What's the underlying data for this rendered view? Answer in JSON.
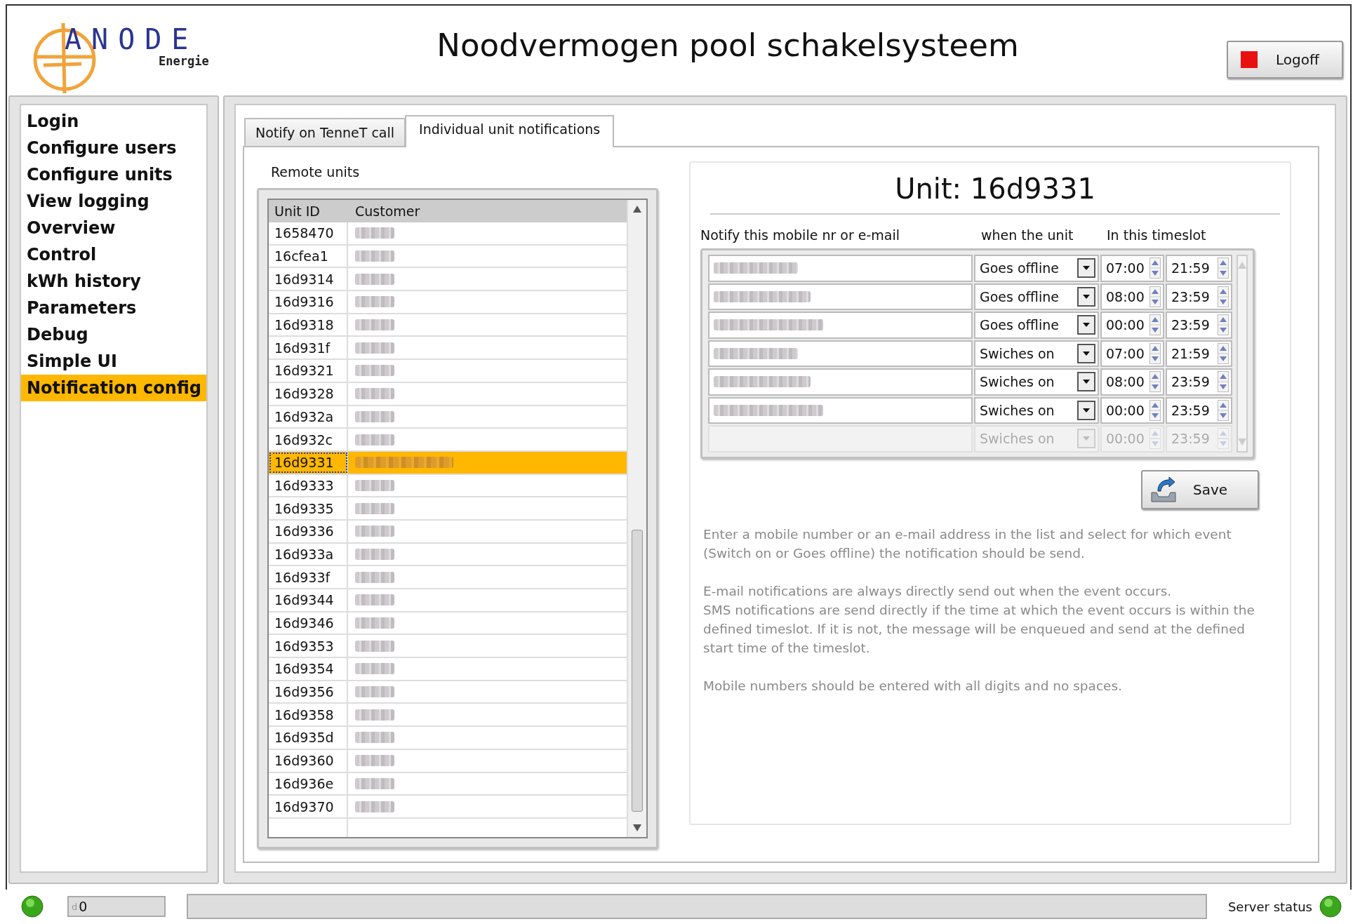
{
  "header": {
    "logo": {
      "name": "ANODE",
      "tagline": "Energie"
    },
    "title": "Noodvermogen pool schakelsysteem",
    "logoff": {
      "label": "Logoff"
    }
  },
  "sidebar": {
    "items": [
      {
        "label": "Login",
        "selected": false
      },
      {
        "label": "Configure users",
        "selected": false
      },
      {
        "label": "Configure units",
        "selected": false
      },
      {
        "label": "View logging",
        "selected": false
      },
      {
        "label": "Overview",
        "selected": false
      },
      {
        "label": "Control",
        "selected": false
      },
      {
        "label": "kWh history",
        "selected": false
      },
      {
        "label": "Parameters",
        "selected": false
      },
      {
        "label": "Debug",
        "selected": false
      },
      {
        "label": "Simple UI",
        "selected": false
      },
      {
        "label": "Notification config",
        "selected": true
      }
    ]
  },
  "tabs": [
    {
      "label": "Notify on TenneT call",
      "selected": false
    },
    {
      "label": "Individual unit notifications",
      "selected": true
    }
  ],
  "remote_units": {
    "label": "Remote units",
    "columns": [
      "Unit ID",
      "Customer"
    ],
    "rows": [
      {
        "unit_id": "1658470",
        "selected": false
      },
      {
        "unit_id": "16cfea1",
        "selected": false
      },
      {
        "unit_id": "16d9314",
        "selected": false
      },
      {
        "unit_id": "16d9316",
        "selected": false
      },
      {
        "unit_id": "16d9318",
        "selected": false
      },
      {
        "unit_id": "16d931f",
        "selected": false
      },
      {
        "unit_id": "16d9321",
        "selected": false
      },
      {
        "unit_id": "16d9328",
        "selected": false
      },
      {
        "unit_id": "16d932a",
        "selected": false
      },
      {
        "unit_id": "16d932c",
        "selected": false
      },
      {
        "unit_id": "16d9331",
        "selected": true
      },
      {
        "unit_id": "16d9333",
        "selected": false
      },
      {
        "unit_id": "16d9335",
        "selected": false
      },
      {
        "unit_id": "16d9336",
        "selected": false
      },
      {
        "unit_id": "16d933a",
        "selected": false
      },
      {
        "unit_id": "16d933f",
        "selected": false
      },
      {
        "unit_id": "16d9344",
        "selected": false
      },
      {
        "unit_id": "16d9346",
        "selected": false
      },
      {
        "unit_id": "16d9353",
        "selected": false
      },
      {
        "unit_id": "16d9354",
        "selected": false
      },
      {
        "unit_id": "16d9356",
        "selected": false
      },
      {
        "unit_id": "16d9358",
        "selected": false
      },
      {
        "unit_id": "16d935d",
        "selected": false
      },
      {
        "unit_id": "16d9360",
        "selected": false
      },
      {
        "unit_id": "16d936e",
        "selected": false
      },
      {
        "unit_id": "16d9370",
        "selected": false
      }
    ]
  },
  "unit_detail": {
    "title": "Unit: 16d9331",
    "columns": [
      "Notify this mobile nr or e-mail",
      "when the unit",
      "In this timeslot"
    ],
    "rows": [
      {
        "event": "Goes offline",
        "start": "07:00",
        "end": "21:59",
        "disabled": false
      },
      {
        "event": "Goes offline",
        "start": "08:00",
        "end": "23:59",
        "disabled": false
      },
      {
        "event": "Goes offline",
        "start": "00:00",
        "end": "23:59",
        "disabled": false
      },
      {
        "event": "Swiches on",
        "start": "07:00",
        "end": "21:59",
        "disabled": false
      },
      {
        "event": "Swiches on",
        "start": "08:00",
        "end": "23:59",
        "disabled": false
      },
      {
        "event": "Swiches on",
        "start": "00:00",
        "end": "23:59",
        "disabled": false
      },
      {
        "event": "Swiches on",
        "start": "00:00",
        "end": "23:59",
        "disabled": true
      }
    ],
    "save": {
      "label": "Save"
    },
    "help": [
      [
        "Enter a mobile number or an e-mail address in the list and select for which event (Switch on or Goes offline) the notification should be send."
      ],
      [
        "E-mail notifications are always directly send out when the event occurs.",
        "SMS notifications are send directly if the time at which the event occurs is within the defined timeslot. If it is not, the message will be enqueued and send at the defined start time of the timeslot."
      ],
      [
        "Mobile numbers should be entered with all digits and no spaces."
      ]
    ]
  },
  "status_bar": {
    "counter_prefix": "d",
    "counter": "0",
    "server_status": "Server status"
  }
}
